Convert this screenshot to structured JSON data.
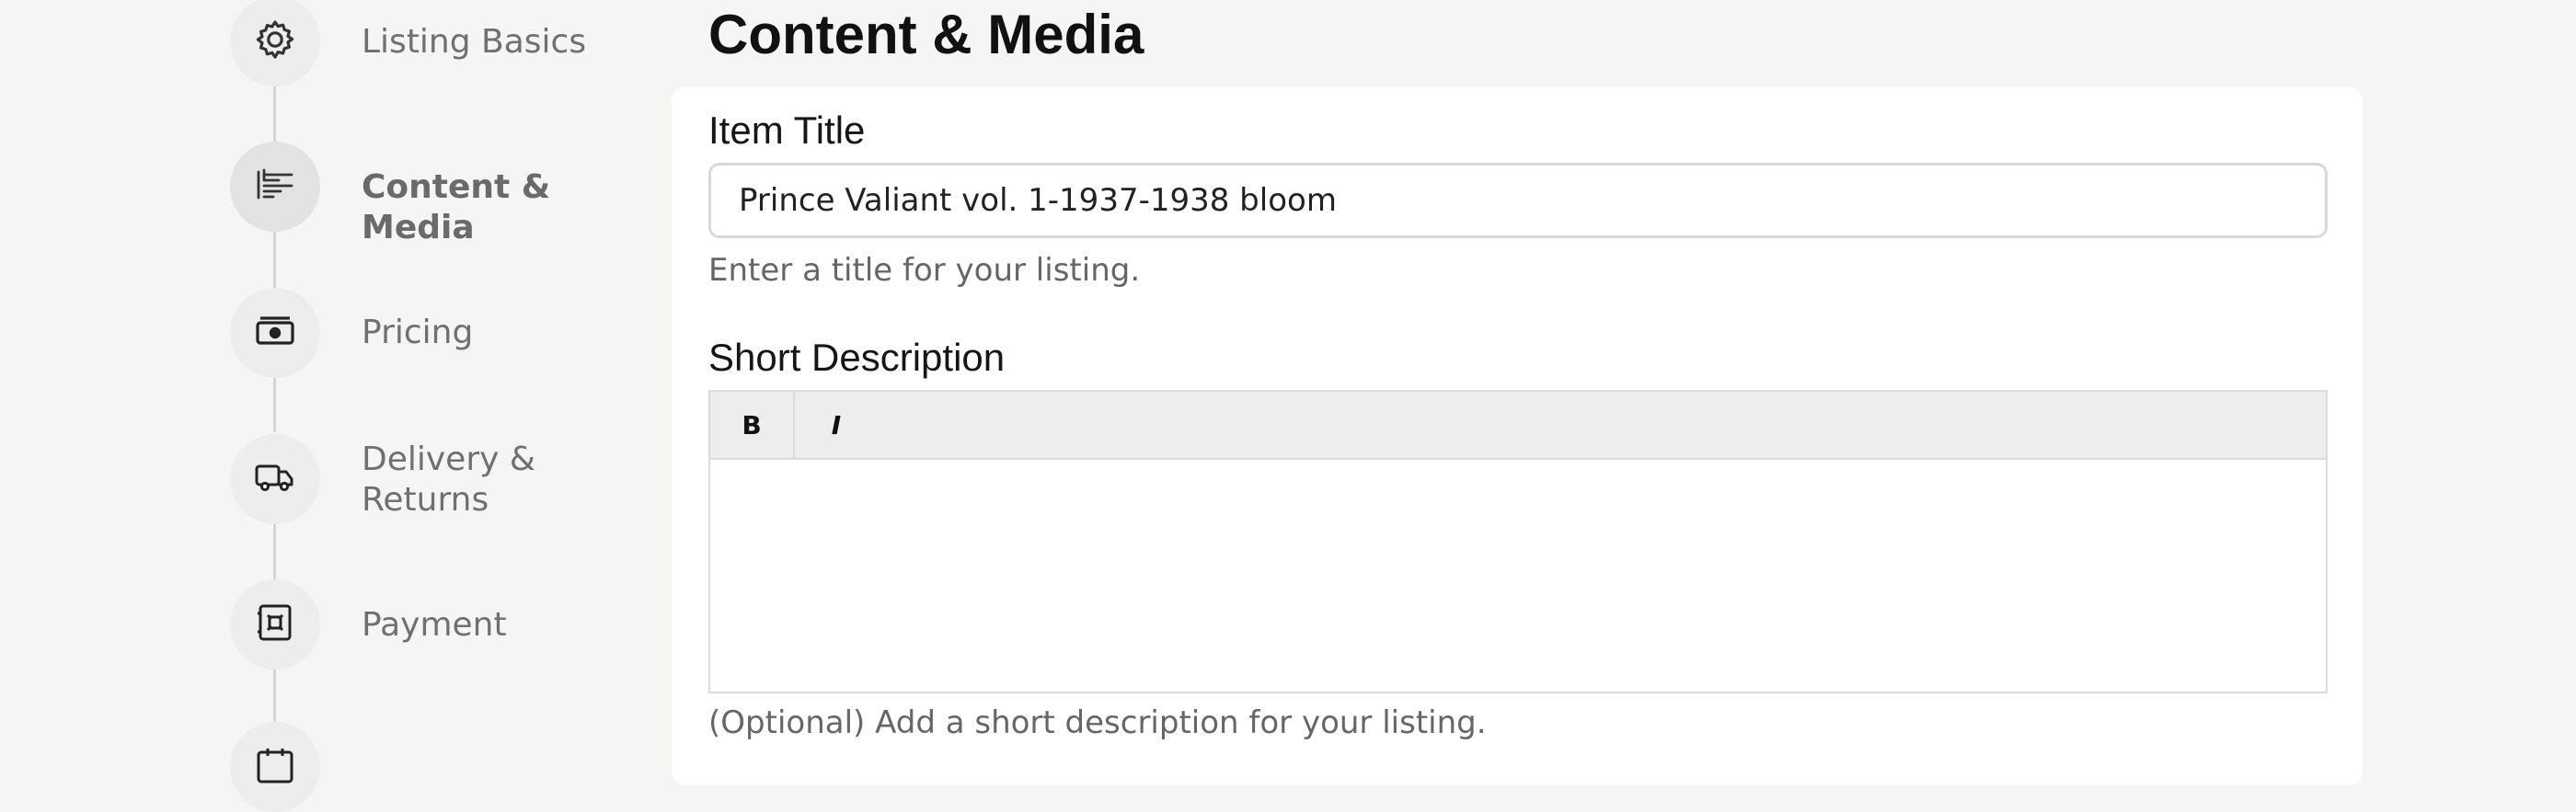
{
  "stepper": {
    "steps": [
      {
        "label": "Listing Basics",
        "icon": "gear-icon"
      },
      {
        "label": "Content & Media",
        "icon": "text-lines-icon",
        "active": true
      },
      {
        "label": "Pricing",
        "icon": "banknote-icon"
      },
      {
        "label": "Delivery & Returns",
        "icon": "truck-icon"
      },
      {
        "label": "Payment",
        "icon": "safe-icon"
      },
      {
        "label": "",
        "icon": "calendar-icon"
      }
    ]
  },
  "main": {
    "title": "Content & Media",
    "item_title": {
      "label": "Item Title",
      "value": "Prince Valiant vol. 1-1937-1938 bloom",
      "help": "Enter a title for your listing."
    },
    "short_description": {
      "label": "Short Description",
      "bold_label": "B",
      "italic_label": "I",
      "value": "",
      "help": "(Optional) Add a short description for your listing."
    }
  }
}
